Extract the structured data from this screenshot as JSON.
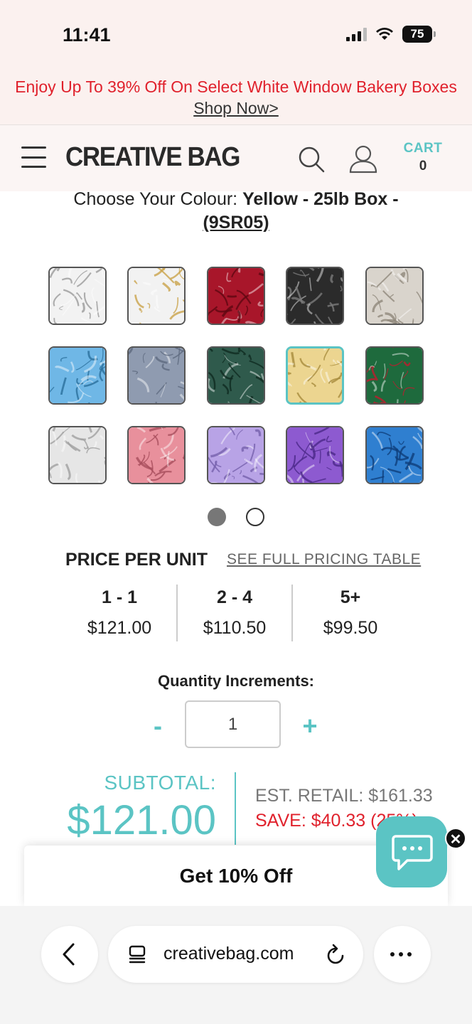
{
  "status": {
    "time": "11:41",
    "battery": "75"
  },
  "promo": {
    "text": "Enjoy Up To 39% Off On Select White Window Bakery Boxes",
    "link": "Shop Now>"
  },
  "header": {
    "logo": "CREATIVE BAG",
    "cart_label": "CART",
    "cart_count": "0"
  },
  "colour": {
    "prefix": "Choose Your Colour:",
    "selected": "Yellow - 25lb Box -",
    "code": "(9SR05)"
  },
  "swatches": [
    {
      "name": "white",
      "base": "#f2f2f2",
      "strand": "#9a9a9a"
    },
    {
      "name": "white-gold",
      "base": "#f2f2f2",
      "strand": "#c9a24a"
    },
    {
      "name": "red",
      "base": "#a8162a",
      "strand": "#5e0812"
    },
    {
      "name": "black",
      "base": "#2b2b2b",
      "strand": "#7a7a7a"
    },
    {
      "name": "kraft",
      "base": "#d9d4cc",
      "strand": "#8e877b"
    },
    {
      "name": "light-blue",
      "base": "#6fb7e6",
      "strand": "#2b6f9c"
    },
    {
      "name": "silver",
      "base": "#8f9bb0",
      "strand": "#5e6a7f"
    },
    {
      "name": "hunter-green",
      "base": "#2f5a4c",
      "strand": "#0f2a21"
    },
    {
      "name": "yellow",
      "base": "#ecd590",
      "strand": "#a88b3c"
    },
    {
      "name": "red-green",
      "base": "#1e6a3d",
      "strand": "#c21a2e"
    },
    {
      "name": "light-silver",
      "base": "#e6e6e6",
      "strand": "#a0a0a0"
    },
    {
      "name": "pink",
      "base": "#e8909c",
      "strand": "#a84e5c"
    },
    {
      "name": "lavender",
      "base": "#b8a3e6",
      "strand": "#7560ad"
    },
    {
      "name": "purple",
      "base": "#8d5ad0",
      "strand": "#4b2888"
    },
    {
      "name": "blue",
      "base": "#2f7fd0",
      "strand": "#0f3f7a"
    }
  ],
  "selected_swatch": "yellow",
  "pricing": {
    "heading": "PRICE PER UNIT",
    "link": "SEE FULL PRICING TABLE",
    "tiers": [
      {
        "qty": "1 - 1",
        "price": "$121.00"
      },
      {
        "qty": "2 - 4",
        "price": "$110.50"
      },
      {
        "qty": "5+",
        "price": "$99.50"
      }
    ]
  },
  "quantity": {
    "label": "Quantity Increments:",
    "minus": "-",
    "plus": "+",
    "value": "1"
  },
  "summary": {
    "subtotal_label": "SUBTOTAL:",
    "subtotal_value": "$121.00",
    "est_retail": "EST. RETAIL: $161.33",
    "save": "SAVE: $40.33 (25%)"
  },
  "popup": {
    "title": "Get 10% Off"
  },
  "browser": {
    "url": "creativebag.com"
  },
  "colors": {
    "accent": "#5bc4c4",
    "sale_red": "#e0212c"
  }
}
